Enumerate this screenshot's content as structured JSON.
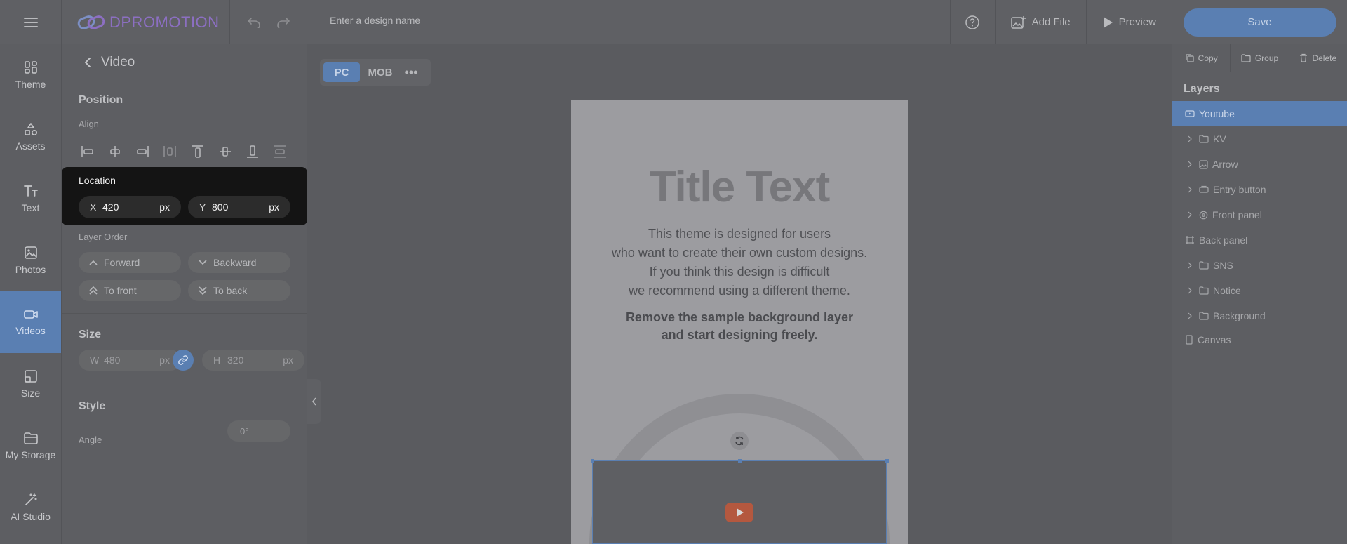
{
  "colors": {
    "accent": "#5a7fb2",
    "logo": "#8c6fc2",
    "youtube": "#b4583f"
  },
  "topbar": {
    "logo_text": "DPROMOTION",
    "design_name_placeholder": "Enter a design name",
    "add_file_label": "Add File",
    "preview_label": "Preview",
    "save_label": "Save"
  },
  "nav": {
    "items": [
      {
        "label": "Theme",
        "icon": "layout-icon"
      },
      {
        "label": "Assets",
        "icon": "shapes-icon"
      },
      {
        "label": "Text",
        "icon": "text-icon"
      },
      {
        "label": "Photos",
        "icon": "image-icon"
      },
      {
        "label": "Videos",
        "icon": "video-icon",
        "active": true
      },
      {
        "label": "Size",
        "icon": "resize-icon"
      },
      {
        "label": "My Storage",
        "icon": "folder-icon"
      },
      {
        "label": "AI Studio",
        "icon": "magic-wand-icon"
      }
    ]
  },
  "panel": {
    "title": "Video",
    "position_title": "Position",
    "align_label": "Align",
    "location_label": "Location",
    "x_key": "X",
    "x_value": "420",
    "x_unit": "px",
    "y_key": "Y",
    "y_value": "800",
    "y_unit": "px",
    "layer_order_label": "Layer Order",
    "forward": "Forward",
    "backward": "Backward",
    "to_front": "To front",
    "to_back": "To back",
    "size_title": "Size",
    "w_key": "W",
    "w_value": "480",
    "w_unit": "px",
    "h_key": "H",
    "h_value": "320",
    "h_unit": "px",
    "style_title": "Style",
    "angle_label": "Angle",
    "angle_value": "0°"
  },
  "canvas": {
    "view_pc": "PC",
    "view_mob": "MOB",
    "view_more": "•••",
    "title_text": "Title Text",
    "body_lines": [
      "This theme is designed for users",
      "who want to create their own custom designs.",
      "If you think this design is difficult",
      "we recommend using a different theme."
    ],
    "bold_lines": [
      "Remove the sample background layer",
      "and start designing freely."
    ]
  },
  "rightpanel": {
    "copy": "Copy",
    "group": "Group",
    "delete": "Delete",
    "layers_title": "Layers",
    "layers": [
      {
        "label": "Youtube",
        "icon": "video-icon",
        "active": true,
        "expandable": false
      },
      {
        "label": "KV",
        "icon": "folder-icon",
        "expandable": true
      },
      {
        "label": "Arrow",
        "icon": "image-icon",
        "expandable": true
      },
      {
        "label": "Entry button",
        "icon": "button-icon",
        "expandable": true
      },
      {
        "label": "Front panel",
        "icon": "gear-icon",
        "expandable": true
      },
      {
        "label": "Back panel",
        "icon": "frame-icon",
        "expandable": false
      },
      {
        "label": "SNS",
        "icon": "folder-icon",
        "expandable": true
      },
      {
        "label": "Notice",
        "icon": "folder-icon",
        "expandable": true
      },
      {
        "label": "Background",
        "icon": "folder-icon",
        "expandable": true
      },
      {
        "label": "Canvas",
        "icon": "canvas-icon",
        "expandable": false
      }
    ]
  }
}
